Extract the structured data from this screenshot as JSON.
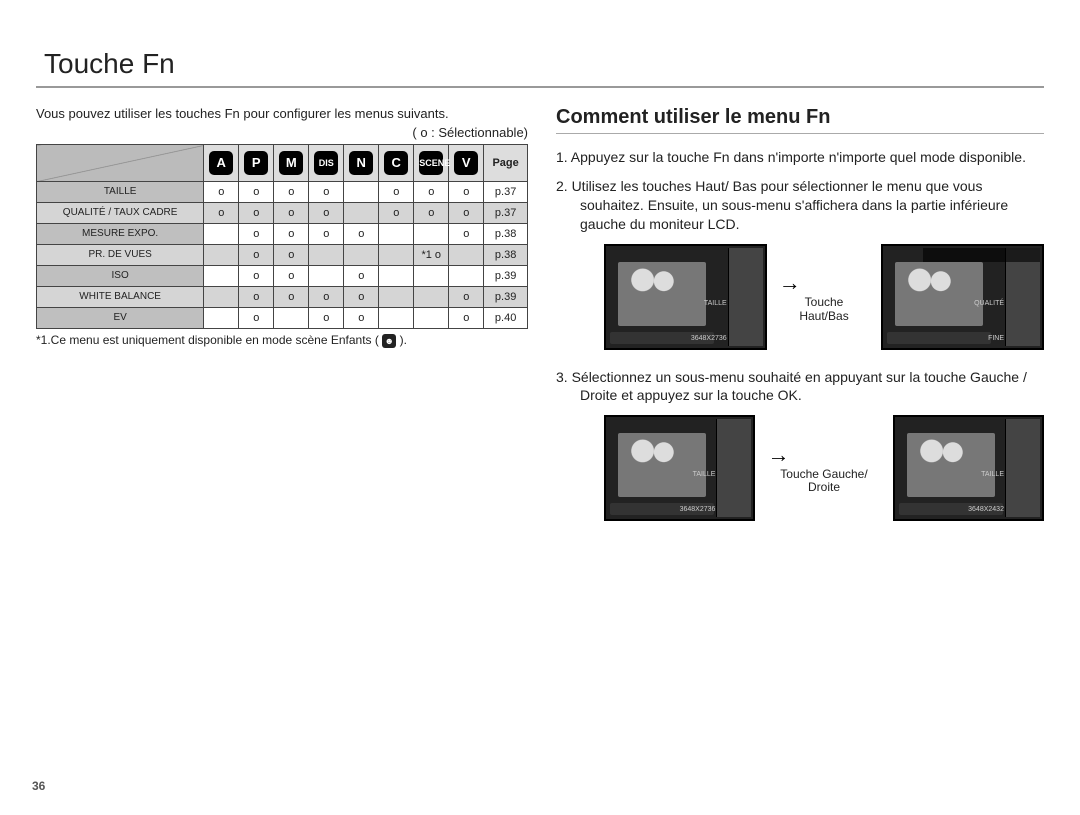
{
  "page_number": "36",
  "title": "Touche Fn",
  "left": {
    "intro": "Vous pouvez utiliser les touches Fn pour configurer les menus suivants.",
    "legend": "( o : Sélectionnable)",
    "table": {
      "mode_icons": [
        "A",
        "P",
        "M",
        "DIS",
        "N",
        "C",
        "SCENE",
        "V"
      ],
      "page_header": "Page",
      "rows": [
        {
          "name": "TAILLE",
          "vals": [
            "o",
            "o",
            "o",
            "o",
            "",
            "o",
            "o",
            "o"
          ],
          "page": "p.37",
          "alt": false
        },
        {
          "name": "QUALITÉ / TAUX CADRE",
          "vals": [
            "o",
            "o",
            "o",
            "o",
            "",
            "o",
            "o",
            "o"
          ],
          "page": "p.37",
          "alt": true
        },
        {
          "name": "MESURE EXPO.",
          "vals": [
            "",
            "o",
            "o",
            "o",
            "o",
            "",
            "",
            "o"
          ],
          "page": "p.38",
          "alt": false
        },
        {
          "name": "PR. DE VUES",
          "vals": [
            "",
            "o",
            "o",
            "",
            "",
            "",
            "*1 o",
            ""
          ],
          "page": "p.38",
          "alt": true
        },
        {
          "name": "ISO",
          "vals": [
            "",
            "o",
            "o",
            "",
            "o",
            "",
            "",
            ""
          ],
          "page": "p.39",
          "alt": false
        },
        {
          "name": "WHITE BALANCE",
          "vals": [
            "",
            "o",
            "o",
            "o",
            "o",
            "",
            "",
            "o"
          ],
          "page": "p.39",
          "alt": true
        },
        {
          "name": "EV",
          "vals": [
            "",
            "o",
            "",
            "o",
            "o",
            "",
            "",
            "o"
          ],
          "page": "p.40",
          "alt": false
        }
      ]
    },
    "footnote_prefix": "*1.Ce menu est uniquement disponible en mode scène Enfants (",
    "footnote_suffix": " )."
  },
  "right": {
    "heading": "Comment utiliser le menu Fn",
    "step1": "1.  Appuyez sur la touche Fn dans n'importe n'importe quel mode disponible.",
    "step2": "2.  Utilisez les touches Haut/ Bas pour sélectionner le menu que vous souhaitez. Ensuite, un sous-menu s'affichera dans la partie inférieure gauche du moniteur LCD.",
    "step3": "3.  Sélectionnez un sous-menu souhaité en appuyant sur la touche Gauche / Droite et appuyez sur la touche OK.",
    "fig1": {
      "caption": "Touche Haut/Bas",
      "screenA": {
        "menu": "TAILLE",
        "res": "3648X2736"
      },
      "screenB": {
        "menu": "QUALITÉ",
        "res": "FINE"
      }
    },
    "fig2": {
      "caption": "Touche Gauche/ Droite",
      "screenA": {
        "menu": "TAILLE",
        "res": "3648X2736"
      },
      "screenB": {
        "menu": "TAILLE",
        "res": "3648X2432"
      }
    }
  }
}
